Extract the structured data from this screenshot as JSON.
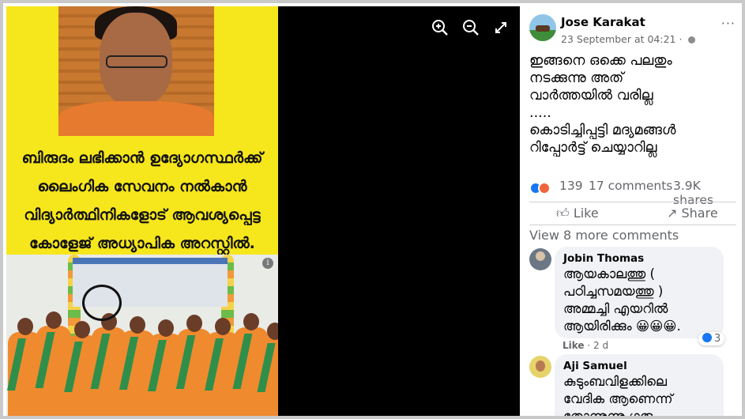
{
  "image": {
    "headline_lines": [
      "ബിരുദം ലഭിക്കാൻ ഉദ്യോഗസ്ഥർക്ക്",
      "ലൈംഗിക സേവനം നൽകാൻ",
      "വിദ്യാർത്ഥിനികളോട് ആവശ്യപ്പെട്ട",
      "കോളേജ് അധ്യാപിക അറസ്റ്റിൽ."
    ],
    "info_glyph": "i",
    "colors": {
      "headline_bg": "#f6e61c",
      "viewer_bg": "#000000"
    }
  },
  "viewer_controls": {
    "zoom_in_icon": "zoom-in-icon",
    "zoom_out_icon": "zoom-out-icon",
    "fullscreen_icon": "fullscreen-icon"
  },
  "post": {
    "author": "Jose Karakat",
    "time": "23 September at 04:21 · ",
    "more": "···",
    "text_lines": [
      "ഇങ്ങനെ ഒക്കെ പലതും",
      "നടക്കുന്നു അത്",
      "വാർത്തയിൽ വരില്ല",
      ".....",
      "കൊടിച്ചിപ്പട്ടി മദ്യമങ്ങൾ",
      "റിപ്പോർട്ട് ചെയ്യാറില്ല"
    ],
    "reaction_count": "139",
    "comments_count": "17 comments",
    "shares_count": "3.9K shares",
    "like_label": "Like",
    "share_label": "Share",
    "view_more_label": "View 8 more comments"
  },
  "comments": [
    {
      "name": "Jobin Thomas",
      "text_lines": [
        "ആയകാലത്തു (",
        "പഠിച്ചസമയത്തു )",
        "അമ്മച്ചി എയറിൽ",
        "ആയിരിക്കും 😀😀😀."
      ],
      "like_label": "Like",
      "age": " · 2 d",
      "likes": "3"
    },
    {
      "name": "Aji Samuel",
      "text_lines": [
        "കുടുംബവിളക്കിലെ",
        "വേദിക ആണെന്ന്",
        "തോന്നുന്നു ഗുരു"
      ]
    }
  ]
}
